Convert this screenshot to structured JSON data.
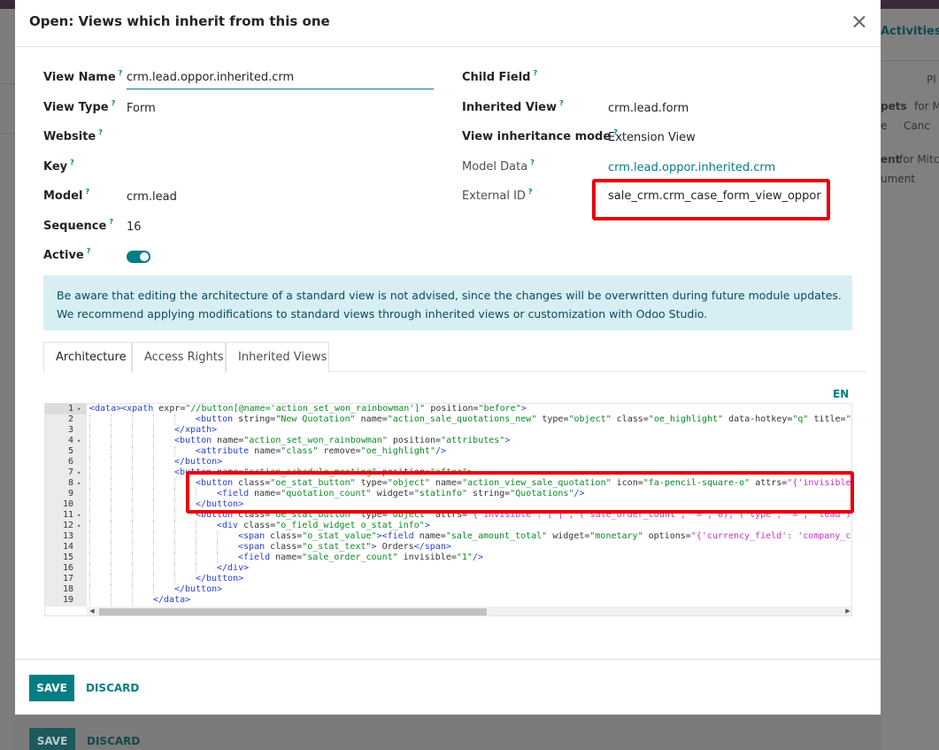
{
  "background": {
    "right_activities": "Activities",
    "right_texts": [
      "Pl",
      "pets",
      "for M",
      "e",
      "Canc",
      "ent",
      "for Mitc",
      "ument"
    ],
    "save_label": "SAVE",
    "discard_label": "DISCARD"
  },
  "modal": {
    "title": "Open: Views which inherit from this one",
    "help_glyph": "?",
    "left_fields": {
      "view_name": {
        "label": "View Name",
        "value": "crm.lead.oppor.inherited.crm"
      },
      "view_type": {
        "label": "View Type",
        "value": "Form"
      },
      "website": {
        "label": "Website",
        "value": ""
      },
      "key": {
        "label": "Key",
        "value": ""
      },
      "model": {
        "label": "Model",
        "value": "crm.lead"
      },
      "sequence": {
        "label": "Sequence",
        "value": "16"
      },
      "active": {
        "label": "Active",
        "value": true
      }
    },
    "right_fields": {
      "child_field": {
        "label": "Child Field",
        "value": ""
      },
      "inherited_view": {
        "label": "Inherited View",
        "value": "crm.lead.form"
      },
      "inheritance_mode": {
        "label": "View inheritance mode",
        "value": "Extension View"
      },
      "model_data": {
        "label": "Model Data",
        "value": "crm.lead.oppor.inherited.crm"
      },
      "external_id": {
        "label": "External ID",
        "value": "sale_crm.crm_case_form_view_oppor"
      }
    },
    "alert": {
      "line1": "Be aware that editing the architecture of a standard view is not advised, since the changes will be overwritten during future module updates.",
      "line2": "We recommend applying modifications to standard views through inherited views or customization with Odoo Studio."
    },
    "tabs": [
      {
        "label": "Architecture",
        "active": true
      },
      {
        "label": "Access Rights",
        "active": false
      },
      {
        "label": "Inherited Views",
        "active": false
      }
    ],
    "lang_button": "EN",
    "code_lines": [
      {
        "n": "1",
        "fold": "▾",
        "indent": 0,
        "tokens": [
          [
            "tag",
            "<data><xpath "
          ],
          [
            "attr",
            "expr="
          ],
          [
            "str",
            "\"//button[@name='action_set_won_rainbowman']\""
          ],
          [
            "attr",
            " position="
          ],
          [
            "str",
            "\"before\""
          ],
          [
            "tag",
            ">"
          ]
        ]
      },
      {
        "n": "2",
        "fold": "",
        "indent": 5,
        "tokens": [
          [
            "tag",
            "<button "
          ],
          [
            "attr",
            "string="
          ],
          [
            "str",
            "\"New Quotation\""
          ],
          [
            "attr",
            " name="
          ],
          [
            "str",
            "\"action_sale_quotations_new\""
          ],
          [
            "attr",
            " type="
          ],
          [
            "str",
            "\"object\""
          ],
          [
            "attr",
            " class="
          ],
          [
            "str",
            "\"oe_highlight\""
          ],
          [
            "attr",
            " data-hotkey="
          ],
          [
            "str",
            "\"q\""
          ],
          [
            "attr",
            " title="
          ],
          [
            "str",
            "\"C"
          ]
        ]
      },
      {
        "n": "3",
        "fold": "",
        "indent": 4,
        "tokens": [
          [
            "tag",
            "</xpath>"
          ]
        ]
      },
      {
        "n": "4",
        "fold": "▾",
        "indent": 4,
        "tokens": [
          [
            "tag",
            "<button "
          ],
          [
            "attr",
            "name="
          ],
          [
            "str",
            "\"action_set_won_rainbowman\""
          ],
          [
            "attr",
            " position="
          ],
          [
            "str",
            "\"attributes\""
          ],
          [
            "tag",
            ">"
          ]
        ]
      },
      {
        "n": "5",
        "fold": "",
        "indent": 5,
        "tokens": [
          [
            "tag",
            "<attribute "
          ],
          [
            "attr",
            "name="
          ],
          [
            "str",
            "\"class\""
          ],
          [
            "attr",
            " remove="
          ],
          [
            "str",
            "\"oe_highlight\""
          ],
          [
            "tag",
            "/>"
          ]
        ]
      },
      {
        "n": "6",
        "fold": "",
        "indent": 4,
        "tokens": [
          [
            "tag",
            "</button>"
          ]
        ]
      },
      {
        "n": "7",
        "fold": "▾",
        "indent": 4,
        "tokens": [
          [
            "tag",
            "<button "
          ],
          [
            "attr",
            "name="
          ],
          [
            "str",
            "\"action_schedule_meeting\""
          ],
          [
            "attr",
            " position="
          ],
          [
            "str",
            "\"after\""
          ],
          [
            "tag",
            ">"
          ]
        ]
      },
      {
        "n": "8",
        "fold": "▾",
        "indent": 5,
        "tokens": [
          [
            "tag",
            "<button "
          ],
          [
            "attr",
            "class="
          ],
          [
            "str",
            "\"oe_stat_button\""
          ],
          [
            "attr",
            " type="
          ],
          [
            "str",
            "\"object\""
          ],
          [
            "attr",
            " name="
          ],
          [
            "str",
            "\"action_view_sale_quotation\""
          ],
          [
            "attr",
            " icon="
          ],
          [
            "str",
            "\"fa-pencil-square-o\""
          ],
          [
            "attr",
            " attrs="
          ],
          [
            "str2",
            "\"{'invisible"
          ]
        ]
      },
      {
        "n": "9",
        "fold": "",
        "indent": 6,
        "tokens": [
          [
            "tag",
            "<field "
          ],
          [
            "attr",
            "name="
          ],
          [
            "str",
            "\"quotation_count\""
          ],
          [
            "attr",
            " widget="
          ],
          [
            "str",
            "\"statinfo\""
          ],
          [
            "attr",
            " string="
          ],
          [
            "str",
            "\"Quotations\""
          ],
          [
            "tag",
            "/>"
          ]
        ]
      },
      {
        "n": "10",
        "fold": "",
        "indent": 5,
        "tokens": [
          [
            "tag",
            "</button>"
          ]
        ]
      },
      {
        "n": "11",
        "fold": "▾",
        "indent": 5,
        "tokens": [
          [
            "tag",
            "<button "
          ],
          [
            "attr",
            "class="
          ],
          [
            "str",
            "\"oe_stat_button\""
          ],
          [
            "attr",
            " type="
          ],
          [
            "str",
            "\"object\""
          ],
          [
            "attr",
            " attrs="
          ],
          [
            "str2",
            "\"{'invisible': ['|', ('sale_order_count', '=', 0), ('type', '=', 'lead')]"
          ]
        ]
      },
      {
        "n": "12",
        "fold": "▾",
        "indent": 6,
        "tokens": [
          [
            "tag",
            "<div "
          ],
          [
            "attr",
            "class="
          ],
          [
            "str",
            "\"o_field_widget o_stat_info\""
          ],
          [
            "tag",
            ">"
          ]
        ]
      },
      {
        "n": "13",
        "fold": "",
        "indent": 7,
        "tokens": [
          [
            "tag",
            "<span "
          ],
          [
            "attr",
            "class="
          ],
          [
            "str",
            "\"o_stat_value\""
          ],
          [
            "tag",
            "><field "
          ],
          [
            "attr",
            "name="
          ],
          [
            "str",
            "\"sale_amount_total\""
          ],
          [
            "attr",
            " widget="
          ],
          [
            "str",
            "\"monetary\""
          ],
          [
            "attr",
            " options="
          ],
          [
            "str2",
            "\"{'currency_field': 'company_cu"
          ]
        ]
      },
      {
        "n": "14",
        "fold": "",
        "indent": 7,
        "tokens": [
          [
            "tag",
            "<span "
          ],
          [
            "attr",
            "class="
          ],
          [
            "str",
            "\"o_stat_text\""
          ],
          [
            "tag",
            ">"
          ],
          [
            "txt",
            " Orders"
          ],
          [
            "tag",
            "</span>"
          ]
        ]
      },
      {
        "n": "15",
        "fold": "",
        "indent": 7,
        "tokens": [
          [
            "tag",
            "<field "
          ],
          [
            "attr",
            "name="
          ],
          [
            "str",
            "\"sale_order_count\""
          ],
          [
            "attr",
            " invisible="
          ],
          [
            "str",
            "\"1\""
          ],
          [
            "tag",
            "/>"
          ]
        ]
      },
      {
        "n": "16",
        "fold": "",
        "indent": 6,
        "tokens": [
          [
            "tag",
            "</div>"
          ]
        ]
      },
      {
        "n": "17",
        "fold": "",
        "indent": 5,
        "tokens": [
          [
            "tag",
            "</button>"
          ]
        ]
      },
      {
        "n": "18",
        "fold": "",
        "indent": 4,
        "tokens": [
          [
            "tag",
            "</button>"
          ]
        ]
      },
      {
        "n": "19",
        "fold": "",
        "indent": 3,
        "tokens": [
          [
            "tag",
            "</data>"
          ]
        ]
      }
    ],
    "footer": {
      "save_label": "SAVE",
      "discard_label": "DISCARD"
    },
    "colors": {
      "primary": "#017e84",
      "highlight_box": "#e8000b",
      "alert_bg": "#d7eff3"
    }
  }
}
